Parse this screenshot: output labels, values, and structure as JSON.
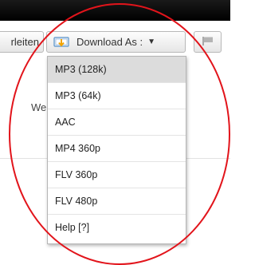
{
  "toolbar": {
    "edit_label": "rleiten",
    "download_label": "Download As :",
    "caret": "▼"
  },
  "background": {
    "partial_text": "We"
  },
  "menu": {
    "items": [
      {
        "label": "MP3 (128k)",
        "highlighted": true
      },
      {
        "label": "MP3 (64k)"
      },
      {
        "label": "AAC"
      },
      {
        "label": "MP4 360p"
      },
      {
        "label": "FLV 360p"
      },
      {
        "label": "FLV 480p"
      },
      {
        "label": "Help [?]"
      }
    ]
  },
  "icons": {
    "download": "download-box-icon",
    "flag": "flag-icon",
    "dropdown": "chevron-down-icon"
  },
  "colors": {
    "highlight": "#dcdcdc",
    "annotation_circle": "#e2141b",
    "icon_arrow": "#f2a400",
    "icon_box": "#5a92c8"
  }
}
